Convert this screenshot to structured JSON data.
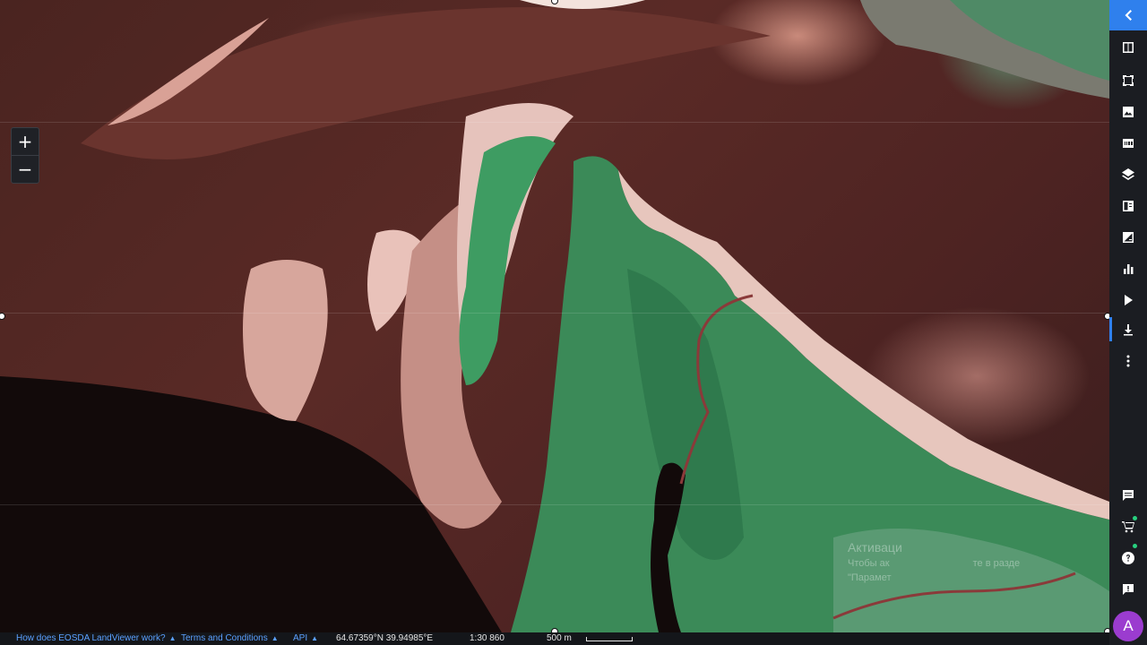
{
  "map": {
    "zoom_in_label": "+",
    "zoom_out_label": "−",
    "watermark": {
      "title": "Активаци",
      "line1": "Чтобы ак",
      "line1_tail": "те в разде",
      "line2": "\"Парамет"
    }
  },
  "sidebar": {
    "items": [
      {
        "icon": "chevron-left-icon"
      },
      {
        "icon": "compare-icon"
      },
      {
        "icon": "crop-area-icon"
      },
      {
        "icon": "image-icon"
      },
      {
        "icon": "hdr-icon"
      },
      {
        "icon": "layers-icon"
      },
      {
        "icon": "split-view-icon"
      },
      {
        "icon": "difference-icon"
      },
      {
        "icon": "bar-chart-icon"
      },
      {
        "icon": "play-icon"
      },
      {
        "icon": "download-icon"
      },
      {
        "icon": "more-vertical-icon"
      },
      {
        "icon": "comment-icon"
      },
      {
        "icon": "cart-icon"
      },
      {
        "icon": "help-icon"
      },
      {
        "icon": "feedback-icon"
      }
    ],
    "avatar_letter": "A",
    "accent_color": "#2f80ed",
    "status_dot_color": "#27d17f"
  },
  "footer": {
    "how_it_works": "How does EOSDA LandViewer work?",
    "terms": "Terms and Conditions",
    "api": "API",
    "coordinates": "64.67359°N 39.94985°E",
    "scale": "1:30 860",
    "scale_bar": "500 m"
  }
}
